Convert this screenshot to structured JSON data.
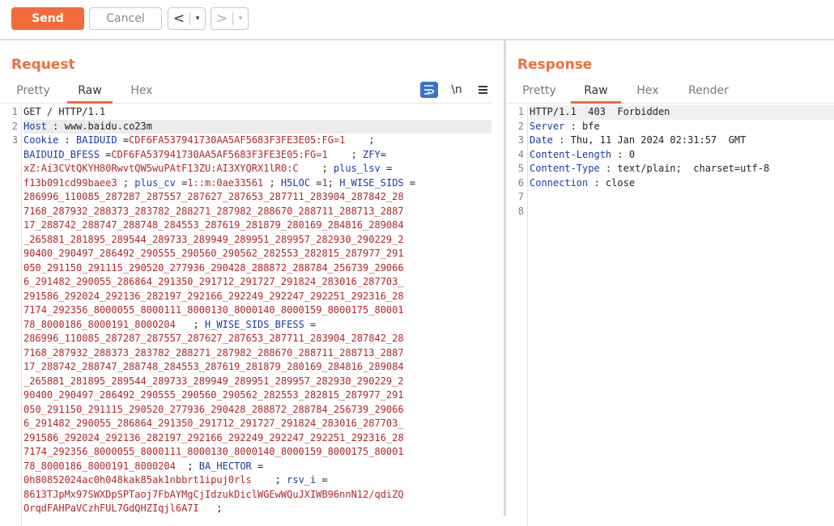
{
  "toolbar": {
    "send_label": "Send",
    "cancel_label": "Cancel",
    "back_arrow": "<",
    "forward_arrow": ">",
    "dropdown_glyph": "▾"
  },
  "request": {
    "title": "Request",
    "tabs": [
      "Pretty",
      "Raw",
      "Hex"
    ],
    "active_tab": "Raw",
    "newline_toggle": "\\n",
    "line_numbers": [
      "1",
      "2",
      "3"
    ],
    "lines": [
      [
        {
          "t": "GET / HTTP/1.1",
          "c": "p"
        }
      ],
      [
        {
          "t": "Host",
          "c": "k"
        },
        {
          "t": " : ",
          "c": "p"
        },
        {
          "t": "www.baidu.co23m",
          "c": "p"
        }
      ],
      [
        {
          "t": "Cookie",
          "c": "k"
        },
        {
          "t": " : ",
          "c": "p"
        },
        {
          "t": "BAIDUID",
          "c": "k"
        },
        {
          "t": " =",
          "c": "p"
        },
        {
          "t": "CDF6FA537941730AA5AF5683F3FE3E05:FG=1",
          "c": "v"
        },
        {
          "t": "    ;",
          "c": "p"
        }
      ],
      [
        {
          "t": "BAIDUID_BFESS",
          "c": "k"
        },
        {
          "t": " =",
          "c": "p"
        },
        {
          "t": "CDF6FA537941730AA5AF5683F3FE3E05:FG=1",
          "c": "v"
        },
        {
          "t": "    ; ",
          "c": "p"
        },
        {
          "t": "ZFY",
          "c": "k"
        },
        {
          "t": "=",
          "c": "p"
        }
      ],
      [
        {
          "t": "xZ:Ai3CVtQKYH80RwvtQW5wuPAtF13ZU:AI3XYQRX1lR0:C",
          "c": "v"
        },
        {
          "t": "    ; ",
          "c": "p"
        },
        {
          "t": "plus_lsv",
          "c": "k"
        },
        {
          "t": " =",
          "c": "p"
        }
      ],
      [
        {
          "t": "f13b091cd99baee3",
          "c": "v"
        },
        {
          "t": " ; ",
          "c": "p"
        },
        {
          "t": "plus_cv",
          "c": "k"
        },
        {
          "t": " =",
          "c": "p"
        },
        {
          "t": "1::m:0ae33561",
          "c": "v"
        },
        {
          "t": " ; ",
          "c": "p"
        },
        {
          "t": "H5LOC",
          "c": "k"
        },
        {
          "t": " =",
          "c": "p"
        },
        {
          "t": "1",
          "c": "v"
        },
        {
          "t": "; ",
          "c": "p"
        },
        {
          "t": "H_WISE_SIDS",
          "c": "k"
        },
        {
          "t": " =",
          "c": "p"
        }
      ],
      [
        {
          "t": "286996_110085_287287_287557_287627_287653_287711_283904_287842_28",
          "c": "v"
        }
      ],
      [
        {
          "t": "7168_287932_288373_283782_288271_287982_288670_288711_288713_2887",
          "c": "v"
        }
      ],
      [
        {
          "t": "17_288742_288747_288748_284553_287619_281879_280169_284816_289084",
          "c": "v"
        }
      ],
      [
        {
          "t": "_265881_281895_289544_289733_289949_289951_289957_282930_290229_2",
          "c": "v"
        }
      ],
      [
        {
          "t": "90400_290497_286492_290555_290560_290562_282553_282815_287977_291",
          "c": "v"
        }
      ],
      [
        {
          "t": "050_291150_291115_290520_277936_290428_288872_288784_256739_29066",
          "c": "v"
        }
      ],
      [
        {
          "t": "6_291482_290055_286864_291350_291712_291727_291824_283016_287703_",
          "c": "v"
        }
      ],
      [
        {
          "t": "291586_292024_292136_282197_292166_292249_292247_292251_292316_28",
          "c": "v"
        }
      ],
      [
        {
          "t": "7174_292356_8000055_8000111_8000130_8000140_8000159_8000175_80001",
          "c": "v"
        }
      ],
      [
        {
          "t": "78_8000186_8000191_8000204",
          "c": "v"
        },
        {
          "t": "   ; ",
          "c": "p"
        },
        {
          "t": "H_WISE_SIDS_BFESS",
          "c": "k"
        },
        {
          "t": " =",
          "c": "p"
        }
      ],
      [
        {
          "t": "286996_110085_287287_287557_287627_287653_287711_283904_287842_28",
          "c": "v"
        }
      ],
      [
        {
          "t": "7168_287932_288373_283782_288271_287982_288670_288711_288713_2887",
          "c": "v"
        }
      ],
      [
        {
          "t": "17_288742_288747_288748_284553_287619_281879_280169_284816_289084",
          "c": "v"
        }
      ],
      [
        {
          "t": "_265881_281895_289544_289733_289949_289951_289957_282930_290229_2",
          "c": "v"
        }
      ],
      [
        {
          "t": "90400_290497_286492_290555_290560_290562_282553_282815_287977_291",
          "c": "v"
        }
      ],
      [
        {
          "t": "050_291150_291115_290520_277936_290428_288872_288784_256739_29066",
          "c": "v"
        }
      ],
      [
        {
          "t": "6_291482_290055_286864_291350_291712_291727_291824_283016_287703_",
          "c": "v"
        }
      ],
      [
        {
          "t": "291586_292024_292136_282197_292166_292249_292247_292251_292316_28",
          "c": "v"
        }
      ],
      [
        {
          "t": "7174_292356_8000055_8000111_8000130_8000140_8000159_8000175_80001",
          "c": "v"
        }
      ],
      [
        {
          "t": "78_8000186_8000191_8000204",
          "c": "v"
        },
        {
          "t": "  ; ",
          "c": "p"
        },
        {
          "t": "BA_HECTOR",
          "c": "k"
        },
        {
          "t": " =",
          "c": "p"
        }
      ],
      [
        {
          "t": "0h80852024ac0h048kak85ak1nbbrt1ipuj0rls",
          "c": "v"
        },
        {
          "t": "    ; ",
          "c": "p"
        },
        {
          "t": "rsv_i",
          "c": "k"
        },
        {
          "t": " =",
          "c": "p"
        }
      ],
      [
        {
          "t": "8613TJpMx97SWXDpSPTaoj7FbAYMgCjIdzukDiclWGEwWQuJXIWB96nnN12/qdiZQ",
          "c": "v"
        }
      ],
      [
        {
          "t": "OrqdFAHPaVCzhFUL7GdQHZIqjl6A7I",
          "c": "v"
        },
        {
          "t": "   ;",
          "c": "p"
        }
      ]
    ]
  },
  "response": {
    "title": "Response",
    "tabs": [
      "Pretty",
      "Raw",
      "Hex",
      "Render"
    ],
    "active_tab": "Raw",
    "line_numbers": [
      "1",
      "2",
      "3",
      "4",
      "5",
      "6",
      "7",
      "8"
    ],
    "lines": [
      [
        {
          "t": "HTTP/1.1  403  Forbidden",
          "c": "p"
        }
      ],
      [
        {
          "t": "Server",
          "c": "k"
        },
        {
          "t": " : ",
          "c": "p"
        },
        {
          "t": "bfe",
          "c": "p"
        }
      ],
      [
        {
          "t": "Date",
          "c": "k"
        },
        {
          "t": " : ",
          "c": "p"
        },
        {
          "t": "Thu, 11 Jan 2024 02:31:57  GMT",
          "c": "p"
        }
      ],
      [
        {
          "t": "Content-Length",
          "c": "k"
        },
        {
          "t": " : ",
          "c": "p"
        },
        {
          "t": "0",
          "c": "p"
        }
      ],
      [
        {
          "t": "Content-Type",
          "c": "k"
        },
        {
          "t": " : ",
          "c": "p"
        },
        {
          "t": "text/plain;  charset=utf-8",
          "c": "p"
        }
      ],
      [
        {
          "t": "Connection",
          "c": "k"
        },
        {
          "t": " : ",
          "c": "p"
        },
        {
          "t": "close",
          "c": "p"
        }
      ],
      [],
      []
    ]
  },
  "colors": {
    "accent": "#f26b3a",
    "key": "#1a3aa6",
    "value": "#b3262b",
    "icon_blue": "#3a74c6"
  }
}
